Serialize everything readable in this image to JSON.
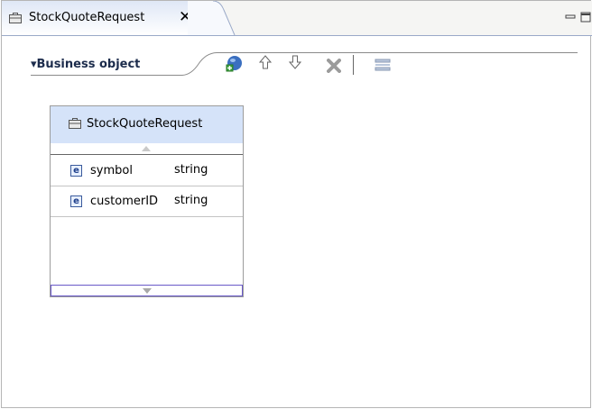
{
  "editor": {
    "tab_title": "StockQuoteRequest",
    "close_symbol": "✕"
  },
  "section": {
    "title": "▾Business object"
  },
  "toolbar": {
    "icons": [
      "add-field-icon",
      "move-up-icon",
      "move-down-icon",
      "delete-icon",
      "list-icon"
    ]
  },
  "business_object": {
    "name": "StockQuoteRequest",
    "fields": [
      {
        "name": "symbol",
        "type": "string",
        "icon_letter": "e"
      },
      {
        "name": "customerID",
        "type": "string",
        "icon_letter": "e"
      }
    ]
  },
  "colors": {
    "tab_gradient_top": "#dfe7f6",
    "header_fill": "#d5e3f9",
    "section_title": "#1c2c4c",
    "add_icon_blue": "#3a6fc0",
    "add_icon_green": "#3ca03c"
  }
}
